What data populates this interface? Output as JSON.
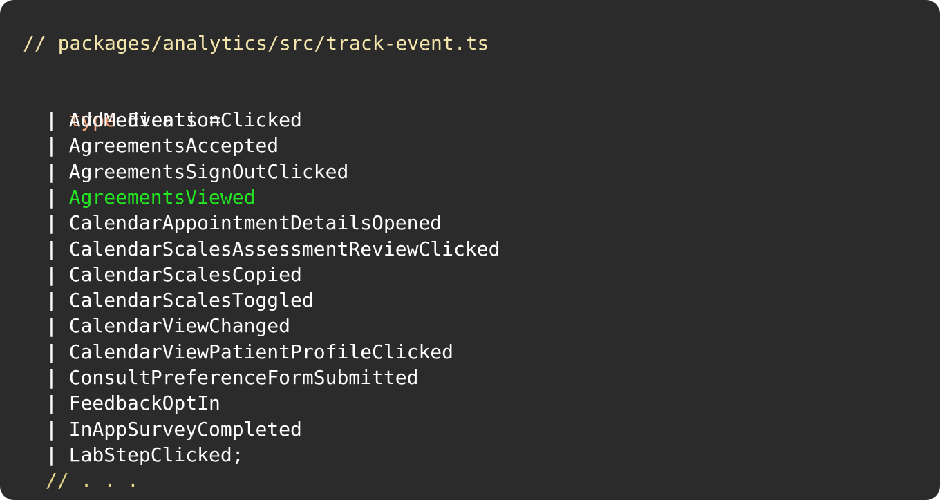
{
  "file_comment": "// packages/analytics/src/track-event.ts",
  "declaration": {
    "keyword": "type",
    "name_and_equals": " Events ="
  },
  "union_pipe": "| ",
  "members": [
    {
      "name": "AddMedicationClicked",
      "highlighted": false
    },
    {
      "name": "AgreementsAccepted",
      "highlighted": false
    },
    {
      "name": "AgreementsSignOutClicked",
      "highlighted": false
    },
    {
      "name": "AgreementsViewed",
      "highlighted": true
    },
    {
      "name": "CalendarAppointmentDetailsOpened",
      "highlighted": false
    },
    {
      "name": "CalendarScalesAssessmentReviewClicked",
      "highlighted": false
    },
    {
      "name": "CalendarScalesCopied",
      "highlighted": false
    },
    {
      "name": "CalendarScalesToggled",
      "highlighted": false
    },
    {
      "name": "CalendarViewChanged",
      "highlighted": false
    },
    {
      "name": "CalendarViewPatientProfileClicked",
      "highlighted": false
    },
    {
      "name": "ConsultPreferenceFormSubmitted",
      "highlighted": false
    },
    {
      "name": "FeedbackOptIn",
      "highlighted": false
    },
    {
      "name": "InAppSurveyCompleted",
      "highlighted": false
    },
    {
      "name": "LabStepClicked;",
      "highlighted": false
    }
  ],
  "trailing_comment": "// . . .",
  "colors": {
    "background": "#2b2b2b",
    "comment": "#f3e5ab",
    "keyword": "#f5a27a",
    "text": "#ffffff",
    "highlight": "#22e622"
  }
}
